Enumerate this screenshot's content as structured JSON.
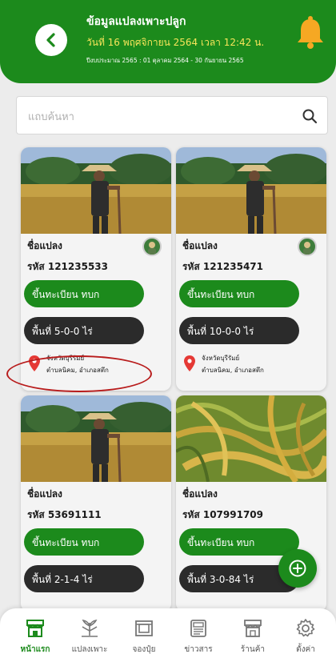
{
  "header": {
    "title": "ข้อมูลแปลงเพาะปลูก",
    "date_text": "วันที่ 16 พฤศจิกายน 2564 เวลา 12:42 น.",
    "budget_text": "ปีงบประมาณ 2565 : 01 ตุลาคม 2564 - 30 กันยายน 2565"
  },
  "search": {
    "placeholder": "แถบค้นหา"
  },
  "plots": [
    {
      "name": "ชื่อแปลง",
      "code": "รหัส 121235533",
      "status": "ขึ้นทะเบียน ทบก",
      "area": "พื้นที่ 5-0-0 ไร่",
      "province": "จังหวัดบุรีรัมย์",
      "district": "ตำบลนิคม, อำเภอสตึก",
      "image": "farmer"
    },
    {
      "name": "ชื่อแปลง",
      "code": "รหัส 121235471",
      "status": "ขึ้นทะเบียน ทบก",
      "area": "พื้นที่ 10-0-0 ไร่",
      "province": "จังหวัดบุรีรัมย์",
      "district": "ตำบลนิคม, อำเภอสตึก",
      "image": "farmer"
    },
    {
      "name": "ชื่อแปลง",
      "code": "รหัส 53691111",
      "status": "ขึ้นทะเบียน ทบก",
      "area": "พื้นที่ 2-1-4 ไร่",
      "image": "farmer"
    },
    {
      "name": "ชื่อแปลง",
      "code": "รหัส 107991709",
      "status": "ขึ้นทะเบียน ทบก",
      "area": "พื้นที่ 3-0-84 ไร่",
      "image": "rice"
    }
  ],
  "nav": [
    {
      "label": "หน้าแรก",
      "icon": "shop-icon",
      "active": true
    },
    {
      "label": "แปลงเพาะ",
      "icon": "plant-icon",
      "active": false
    },
    {
      "label": "จองปุ๋ย",
      "icon": "calendar-icon",
      "active": false
    },
    {
      "label": "ข่าวสาร",
      "icon": "news-icon",
      "active": false
    },
    {
      "label": "ร้านค้า",
      "icon": "store-icon",
      "active": false
    },
    {
      "label": "ตั้งค่า",
      "icon": "gear-icon",
      "active": false
    }
  ],
  "colors": {
    "primary": "#1c8a1c",
    "date_yellow": "#f7e55a",
    "dark_pill": "#2b2b2b",
    "pin_red": "#e53935",
    "highlight": "#b81c1c"
  }
}
